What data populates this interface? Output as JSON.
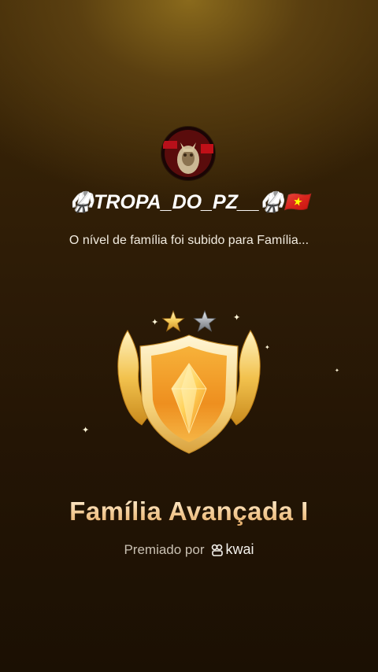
{
  "profile": {
    "avatar_icon": "profile-avatar",
    "username": "🥋TROPA_DO_PZ__🥋🇻🇳"
  },
  "notification": {
    "message": "O nível de família foi subido para Família..."
  },
  "badge": {
    "stars_filled": 1,
    "stars_total": 2,
    "emblem_icon": "gold-shield-crystal-emblem",
    "level_title": "Família Avançada I"
  },
  "award": {
    "prefix": "Premiado por",
    "brand_icon": "kwai-logo-icon",
    "brand": "kwai"
  },
  "colors": {
    "title_gold": "#f2c890",
    "background": "#2f1d06",
    "star_gold": "#f5cc5a",
    "star_silver": "#a9adb3"
  }
}
